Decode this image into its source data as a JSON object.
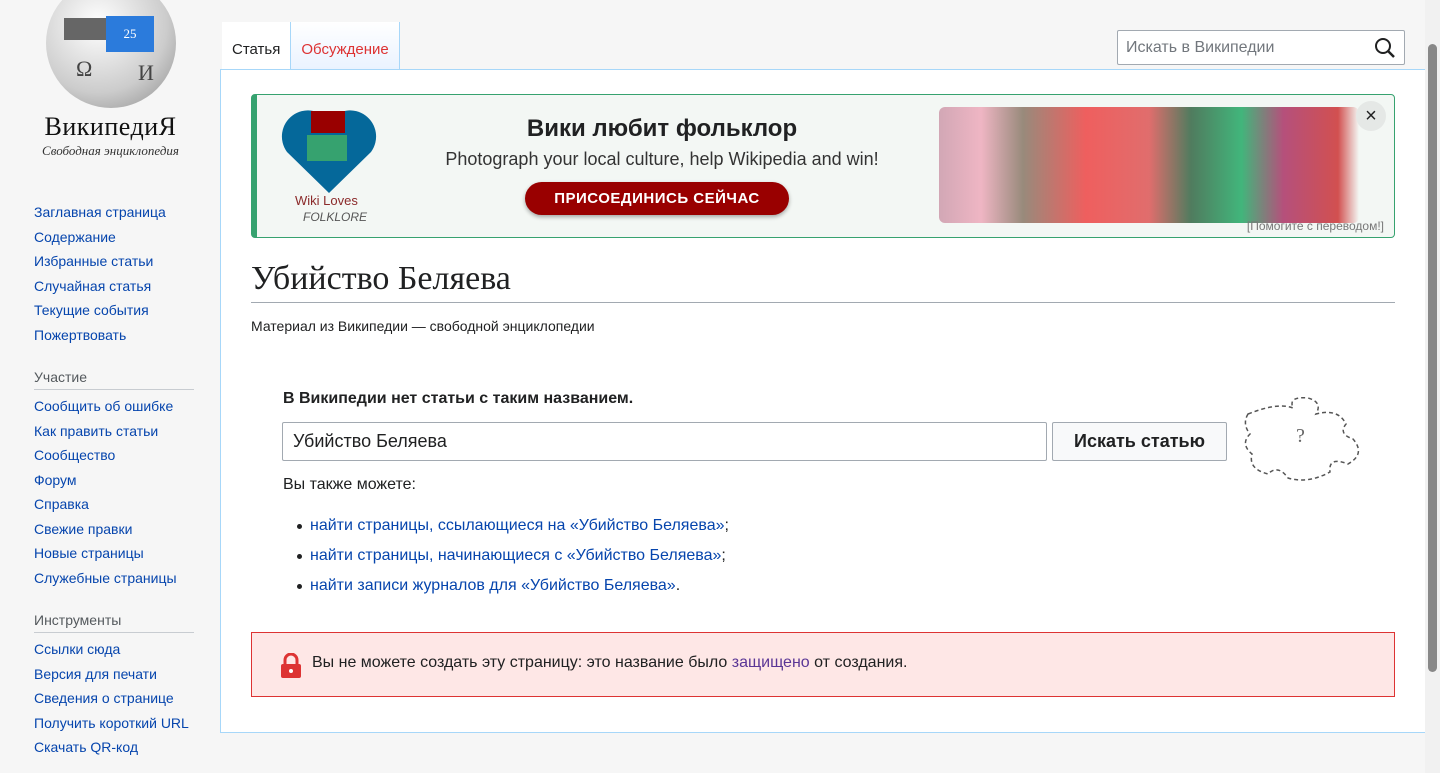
{
  "logo": {
    "wordmark": "ВикипедиЯ",
    "tagline": "Свободная энциклопедия",
    "puzzle_number": "25"
  },
  "sidebar": {
    "main": [
      "Заглавная страница",
      "Содержание",
      "Избранные статьи",
      "Случайная статья",
      "Текущие события",
      "Пожертвовать"
    ],
    "participation": {
      "heading": "Участие",
      "items": [
        "Сообщить об ошибке",
        "Как править статьи",
        "Сообщество",
        "Форум",
        "Справка",
        "Свежие правки",
        "Новые страницы",
        "Служебные страницы"
      ]
    },
    "tools": {
      "heading": "Инструменты",
      "items": [
        "Ссылки сюда",
        "Версия для печати",
        "Сведения о странице",
        "Получить короткий URL",
        "Скачать QR-код"
      ]
    }
  },
  "tabs": [
    {
      "label": "Статья"
    },
    {
      "label": "Обсуждение"
    }
  ],
  "search": {
    "placeholder": "Искать в Википедии"
  },
  "banner": {
    "logo_line1": "Wiki Loves",
    "logo_line2": "FOLKLORE",
    "title": "Вики любит фольклор",
    "subtitle": "Photograph your local culture, help Wikipedia and win!",
    "cta": "ПРИСОЕДИНИСЬ СЕЙЧАС",
    "close": "×",
    "help": "[Помогите с переводом!]"
  },
  "page": {
    "title": "Убийство Беляева",
    "tagline": "Материал из Википедии — свободной энциклопедии",
    "notice": "В Википедии нет статьи с таким названием.",
    "query": "Убийство Беляева",
    "search_button": "Искать статью",
    "also": "Вы также можете:",
    "links": [
      {
        "text": "найти страницы, ссылающиеся на «Убийство Беляева»",
        "end": ";"
      },
      {
        "text": "найти страницы, начинающиеся с «Убийство Беляева»",
        "end": ";"
      },
      {
        "text": "найти записи журналов для «Убийство Беляева»",
        "end": "."
      }
    ],
    "error": {
      "before": "Вы не можете создать эту страницу: это название было ",
      "link": "защищено",
      "after": " от создания."
    }
  }
}
